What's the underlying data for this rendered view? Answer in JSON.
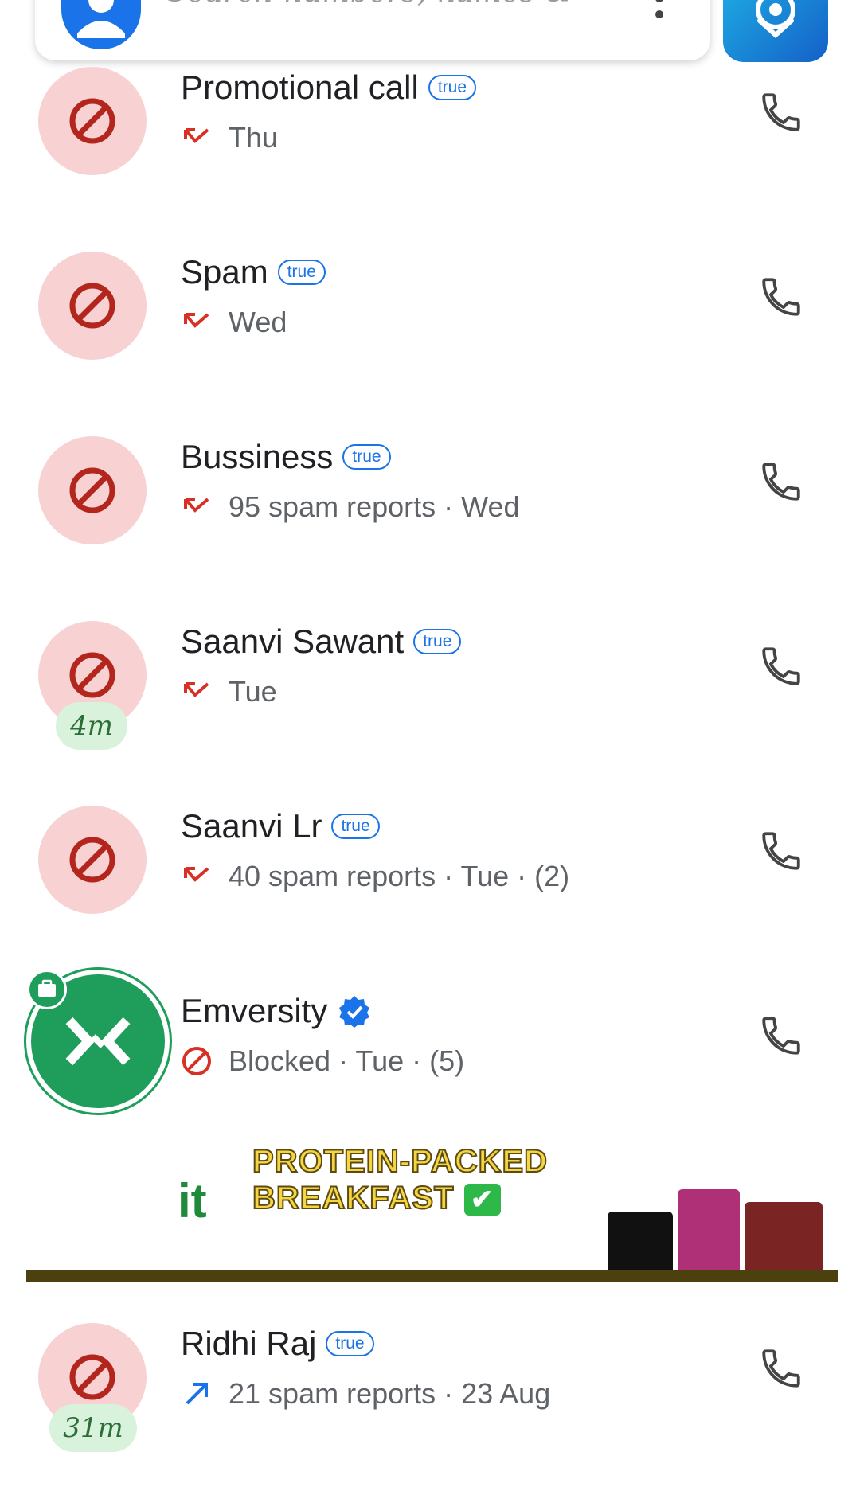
{
  "search": {
    "placeholder": "Search numbers, names & ···"
  },
  "colors": {
    "spam_avatar_bg": "#f8d2d2",
    "block_red": "#b3261e",
    "badge_blue": "#1a73e8",
    "verified_blue": "#1a73e8",
    "business_green": "#1e9e5a"
  },
  "calls": [
    {
      "name": "Promotional call",
      "badge": "true",
      "direction": "missed",
      "detail": "Thu",
      "time_chip": ""
    },
    {
      "name": "Spam",
      "badge": "true",
      "direction": "missed",
      "detail": "Wed",
      "time_chip": ""
    },
    {
      "name": "Bussiness",
      "badge": "true",
      "direction": "missed",
      "detail": "95 spam reports · Wed",
      "time_chip": ""
    },
    {
      "name": "Saanvi Sawant",
      "badge": "true",
      "direction": "missed",
      "detail": "Tue",
      "time_chip": "4m"
    },
    {
      "name": "Saanvi Lr",
      "badge": "true",
      "direction": "missed",
      "detail": "40 spam reports · Tue · (2)",
      "time_chip": ""
    },
    {
      "name": "Emversity",
      "badge": "verified",
      "direction": "blocked",
      "detail": "Blocked · Tue · (5)",
      "time_chip": ""
    },
    {
      "name": "Ridhi Raj",
      "badge": "true",
      "direction": "outgoing",
      "detail": "21 spam reports · 23 Aug",
      "time_chip": "31m"
    }
  ],
  "ad": {
    "brand": "it",
    "line1": "PROTEIN-PACKED",
    "line2": "BREAKFAST",
    "check": "✔"
  },
  "icons": {
    "search_avatar": "person-icon",
    "menu": "more-vert-icon",
    "brand": "truecaller-assistant-icon",
    "call": "phone-icon",
    "block": "block-icon",
    "missed": "missed-call-icon",
    "outgoing": "outgoing-call-icon",
    "verified": "verified-badge-icon",
    "business": "briefcase-icon"
  }
}
